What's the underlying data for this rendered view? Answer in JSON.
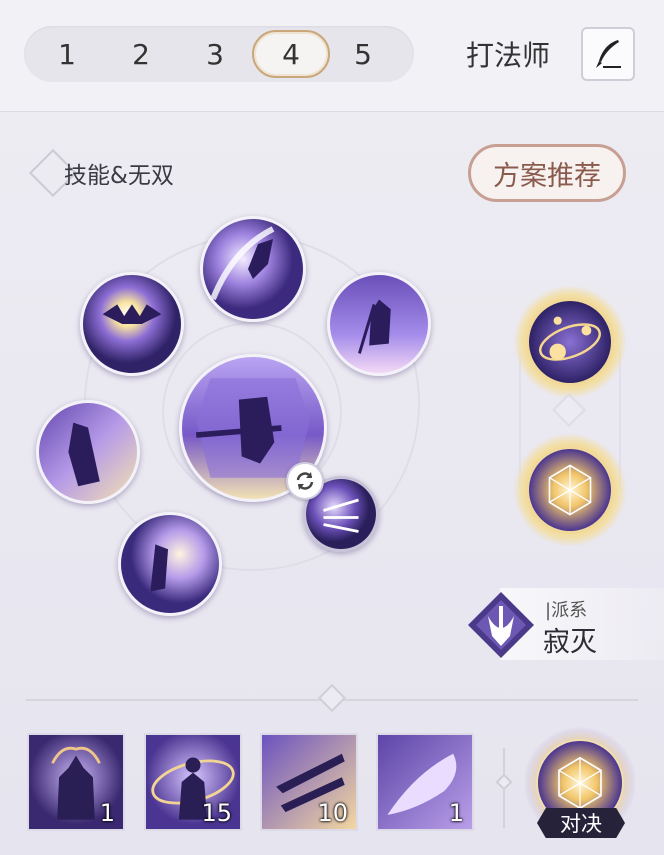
{
  "tabs": [
    "1",
    "2",
    "3",
    "4",
    "5"
  ],
  "active_tab": "4",
  "build_name": "打法师",
  "edit_icon": "quill-pen-icon",
  "section": {
    "title": "技能&无双",
    "recommend_label": "方案推荐"
  },
  "faction": {
    "label": "|派系",
    "name": "寂灭"
  },
  "items": [
    {
      "icon": "flame-warrior-icon",
      "count": "1"
    },
    {
      "icon": "ringed-figure-icon",
      "count": "15"
    },
    {
      "icon": "kunai-icon",
      "count": "10"
    },
    {
      "icon": "comet-icon",
      "count": "1"
    }
  ],
  "duel_label": "对决",
  "colors": {
    "accent_gold": "#c9a77a",
    "recommend_border": "#c79f93",
    "skill_purple": "#6a4fb8"
  }
}
